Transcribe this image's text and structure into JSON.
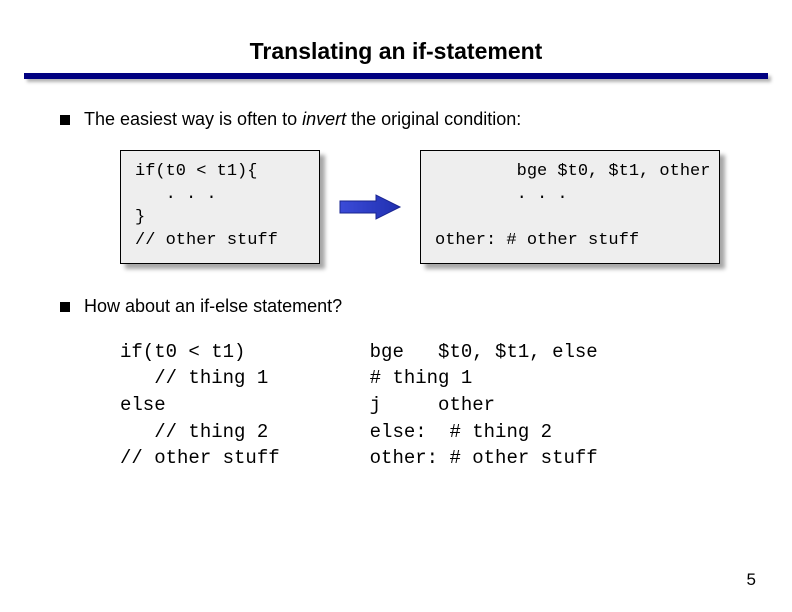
{
  "title": "Translating an if-statement",
  "bullet1_a": "The easiest way is often to ",
  "bullet1_b": "invert",
  "bullet1_c": " the original condition:",
  "code1_left": "if(t0 < t1){\n   . . .\n}\n// other stuff",
  "code1_right": "        bge $t0, $t1, other\n        . . .\n\nother: # other stuff",
  "bullet2": "How about an if-else statement?",
  "code2_left": "if(t0 < t1)\n   // thing 1\nelse\n   // thing 2\n// other stuff",
  "code2_right": "bge   $t0, $t1, else\n# thing 1\nj     other\nelse:  # thing 2\nother: # other stuff",
  "page_number": "5"
}
